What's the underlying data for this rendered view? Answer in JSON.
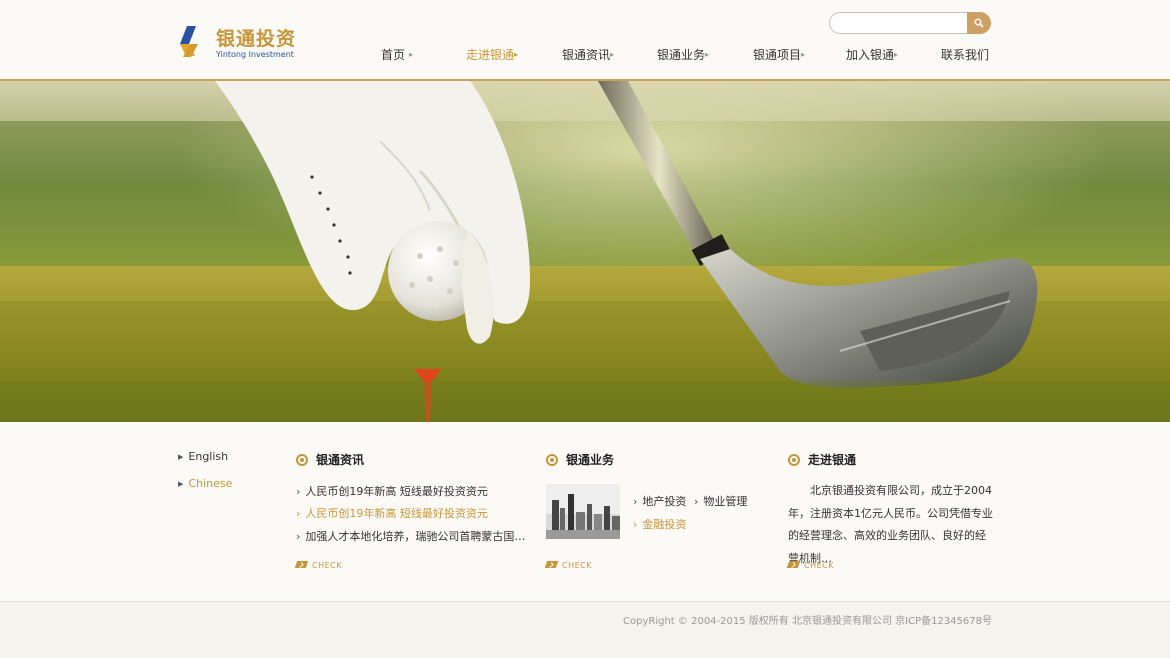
{
  "brand": {
    "name_cn": "银通投资",
    "name_en": "Yintong Investment"
  },
  "search": {
    "placeholder": ""
  },
  "nav": [
    {
      "label": "首页"
    },
    {
      "label": "走进银通"
    },
    {
      "label": "银通资讯"
    },
    {
      "label": "银通业务"
    },
    {
      "label": "银通项目"
    },
    {
      "label": "加入银通"
    },
    {
      "label": "联系我们"
    }
  ],
  "languages": [
    {
      "label": "English"
    },
    {
      "label": "Chinese"
    }
  ],
  "news": {
    "title": "银通资讯",
    "items": [
      {
        "text": "人民币创19年新高 短线最好投资资元"
      },
      {
        "text": "人民币创19年新高 短线最好投资资元"
      },
      {
        "text": "加强人才本地化培养，瑞驰公司首聘蒙古国…"
      }
    ],
    "check": "CHECK"
  },
  "business": {
    "title": "银通业务",
    "items": [
      {
        "text": "地产投资"
      },
      {
        "text": "物业管理"
      },
      {
        "text": "金融投资"
      }
    ],
    "check": "CHECK"
  },
  "about": {
    "title": "走进银通",
    "text": "北京银通投资有限公司，成立于2004年，注册资本1亿元人民币。公司凭借专业的经营理念、高效的业务团队、良好的经营机制…",
    "check": "CHECK"
  },
  "footer": {
    "copyright": "CopyRight © 2004-2015 版权所有  北京银通投资有限公司  京ICP备12345678号"
  },
  "colors": {
    "accent": "#c8963a",
    "logo_blue": "#2a52a0",
    "header_rule": "#c9a25e"
  }
}
